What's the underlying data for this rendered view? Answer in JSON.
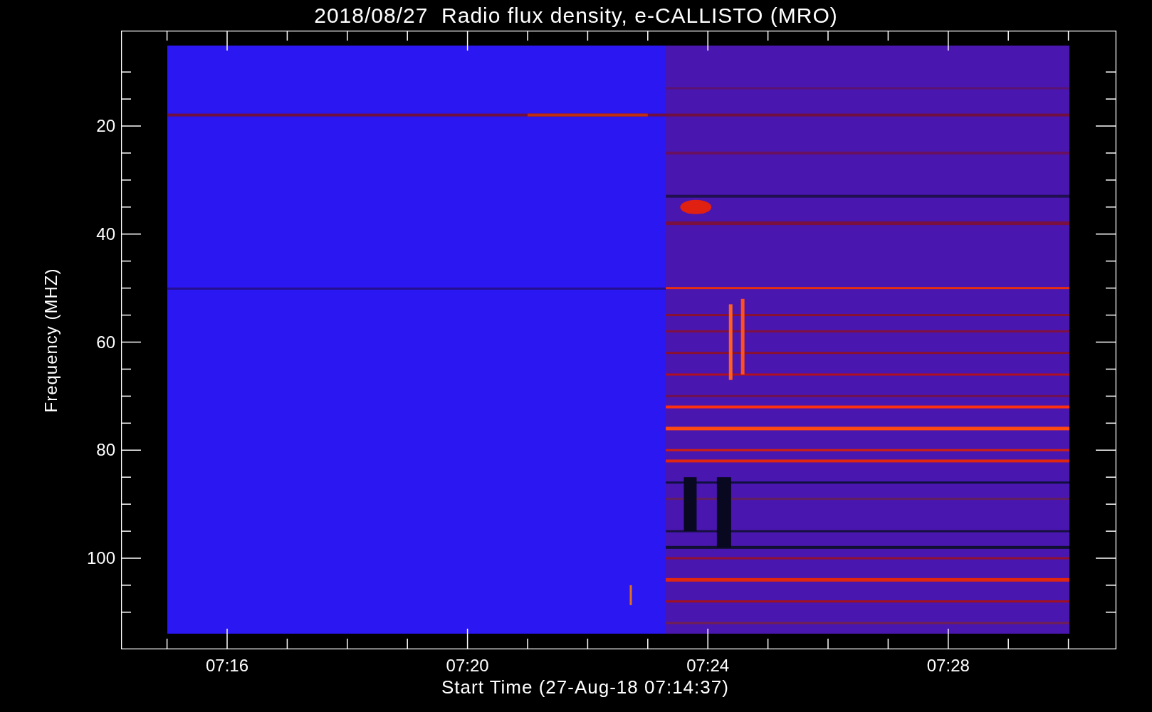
{
  "title": "2018/08/27  Radio flux density, e-CALLISTO (MRO)",
  "y_axis": {
    "label": "Frequency (MHZ)",
    "ticks": [
      "20",
      "40",
      "60",
      "80",
      "100"
    ]
  },
  "x_axis": {
    "label": "Start Time (27-Aug-18 07:14:37)",
    "ticks": [
      "07:16",
      "07:20",
      "07:24",
      "07:28"
    ]
  }
}
